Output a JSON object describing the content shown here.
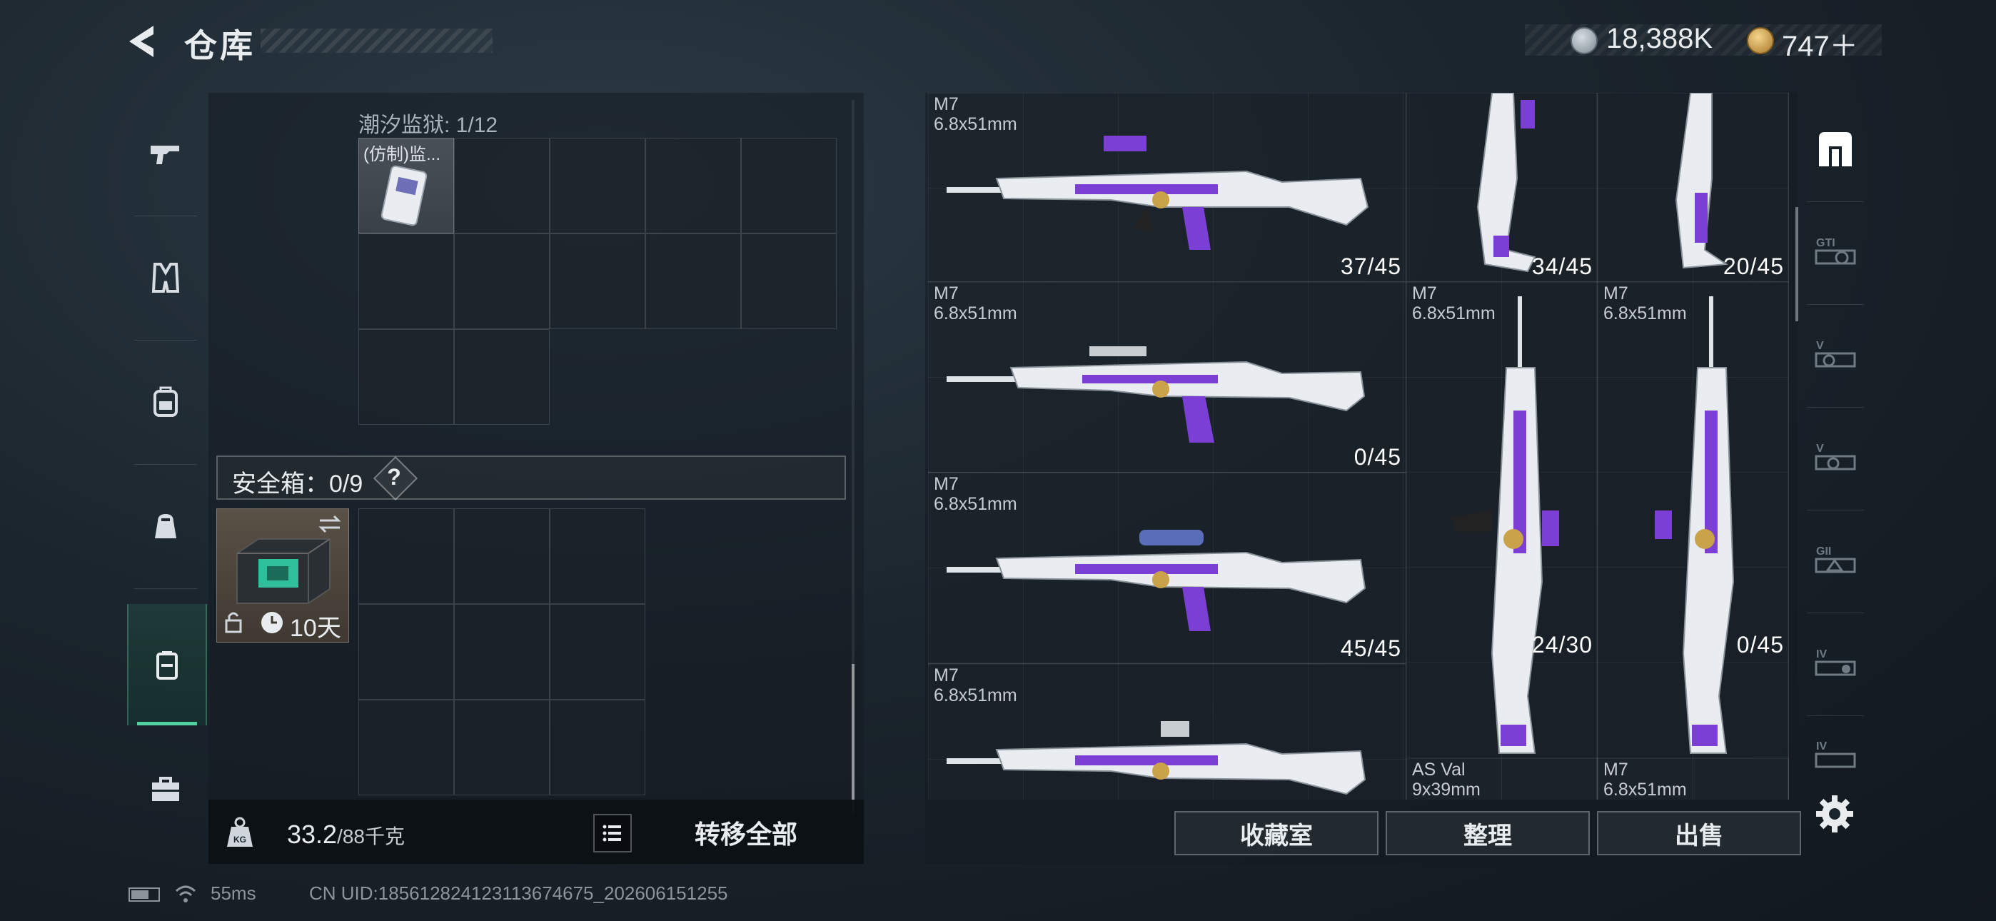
{
  "header": {
    "title": "仓库",
    "currency_1": "18,388K",
    "currency_2": "747＋"
  },
  "left": {
    "prison_label": "潮汐监狱: 1/12",
    "prison_item_name": "(仿制)监...",
    "safebox_label": "安全箱：0/9",
    "safebox_help": "?",
    "case_days": "10天",
    "weight_value": "33.2",
    "weight_max": "/88千克",
    "transfer_label": "转移全部"
  },
  "weapons": [
    {
      "name": "M7",
      "caliber": "6.8x51mm",
      "durability": "37/45"
    },
    {
      "name": "",
      "caliber": "",
      "durability": "34/45"
    },
    {
      "name": "",
      "caliber": "",
      "durability": "20/45"
    },
    {
      "name": "M7",
      "caliber": "6.8x51mm",
      "durability": "0/45"
    },
    {
      "name": "M7",
      "caliber": "6.8x51mm",
      "durability": "24/30"
    },
    {
      "name": "M7",
      "caliber": "6.8x51mm",
      "durability": "0/45"
    },
    {
      "name": "M7",
      "caliber": "6.8x51mm",
      "durability": "45/45"
    },
    {
      "name": "M7",
      "caliber": "6.8x51mm",
      "durability": ""
    },
    {
      "name": "AS Val",
      "caliber": "9x39mm",
      "durability": ""
    },
    {
      "name": "M7",
      "caliber": "6.8x51mm",
      "durability": ""
    }
  ],
  "buttons": {
    "collect": "收藏室",
    "sort": "整理",
    "sell": "出售"
  },
  "status": {
    "ping": "55ms",
    "uid": "CN UID:1856128241231136746​75_202606151255"
  },
  "icons": {
    "left_rail": [
      "pistol-icon",
      "vest-icon",
      "backpack-icon",
      "pouch-icon",
      "safebox-icon",
      "toolbox-icon"
    ],
    "right_tabs": [
      "storage-icon",
      "gti-icon",
      "v-icon",
      "v2-icon",
      "gii-icon",
      "iv-icon",
      "iv2-icon"
    ]
  },
  "colors": {
    "accent": "#4fd1a0",
    "weapon_purple": "#7b3fd6"
  }
}
